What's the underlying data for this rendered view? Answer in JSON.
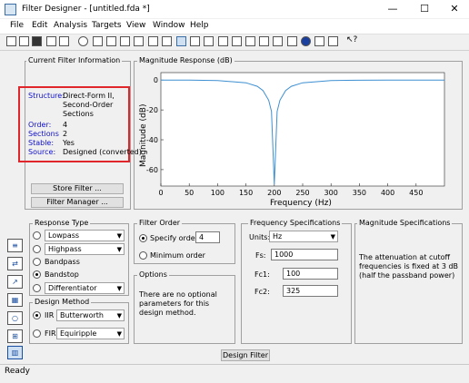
{
  "window": {
    "title": "Filter Designer -  [untitled.fda *]",
    "minimize": "—",
    "maximize": "☐",
    "close": "✕"
  },
  "menu": [
    "File",
    "Edit",
    "Analysis",
    "Targets",
    "View",
    "Window",
    "Help"
  ],
  "current_info": {
    "legend": "Current Filter Information",
    "rows": [
      {
        "label": "Structure:",
        "value": "Direct-Form II, Second-Order Sections"
      },
      {
        "label": "Order:",
        "value": "4"
      },
      {
        "label": "Sections",
        "value": "2"
      },
      {
        "label": "Stable:",
        "value": "Yes"
      },
      {
        "label": "Source:",
        "value": "Designed (converted)"
      }
    ],
    "store_btn": "Store Filter ...",
    "manager_btn": "Filter Manager ..."
  },
  "magnitude": {
    "legend": "Magnitude Response (dB)"
  },
  "chart_data": {
    "type": "line",
    "xlabel": "Frequency (Hz)",
    "ylabel": "Magnitude (dB)",
    "xlim": [
      0,
      500
    ],
    "ylim": [
      -71,
      5
    ],
    "xticks": [
      "0",
      "50",
      "100",
      "150",
      "200",
      "250",
      "300",
      "350",
      "400",
      "450"
    ],
    "yticks": [
      "0",
      "-20",
      "-40",
      "-60"
    ],
    "grid": false,
    "series": [
      {
        "x": [
          0,
          50,
          100,
          150,
          170,
          180,
          190,
          195,
          200,
          205,
          210,
          220,
          230,
          250,
          300,
          350,
          400,
          450,
          500
        ],
        "y": [
          0,
          -0.05,
          -0.3,
          -1.8,
          -4.2,
          -7.0,
          -13.5,
          -21,
          -70,
          -21,
          -13.5,
          -7.0,
          -4.2,
          -1.8,
          -0.3,
          -0.1,
          -0.05,
          -0.02,
          0
        ],
        "color": "#3d8fd1"
      }
    ]
  },
  "response_type": {
    "legend": "Response Type",
    "options": [
      {
        "label": "Lowpass",
        "combo": "Lowpass",
        "selected": false
      },
      {
        "label": "Highpass",
        "combo": "Highpass",
        "selected": false
      },
      {
        "label": "Bandpass",
        "selected": false
      },
      {
        "label": "Bandstop",
        "selected": true
      },
      {
        "combo": "Differentiator",
        "selected": false
      }
    ]
  },
  "design_method": {
    "legend": "Design Method",
    "iir_label": "IIR",
    "iir_value": "Butterworth",
    "fir_label": "FIR",
    "fir_value": "Equiripple"
  },
  "filter_order": {
    "legend": "Filter Order",
    "specify_label": "Specify order:",
    "specify_value": "4",
    "minimum_label": "Minimum order"
  },
  "options": {
    "legend": "Options",
    "text": "There are no optional parameters for this design method."
  },
  "freq_specs": {
    "legend": "Frequency Specifications",
    "units_label": "Units:",
    "units_value": "Hz",
    "fs_label": "Fs:",
    "fs_value": "1000",
    "fc1_label": "Fc1:",
    "fc1_value": "100",
    "fc2_label": "Fc2:",
    "fc2_value": "325"
  },
  "mag_specs": {
    "legend": "Magnitude Specifications",
    "text": "The attenuation at cutoff frequencies is fixed at 3 dB (half the passband power)"
  },
  "design_btn": "Design Filter",
  "status": "Ready",
  "colors": {
    "highlight_box": "#e0262a",
    "curve": "#3d8fd1",
    "label_blue": "#1010c8"
  }
}
